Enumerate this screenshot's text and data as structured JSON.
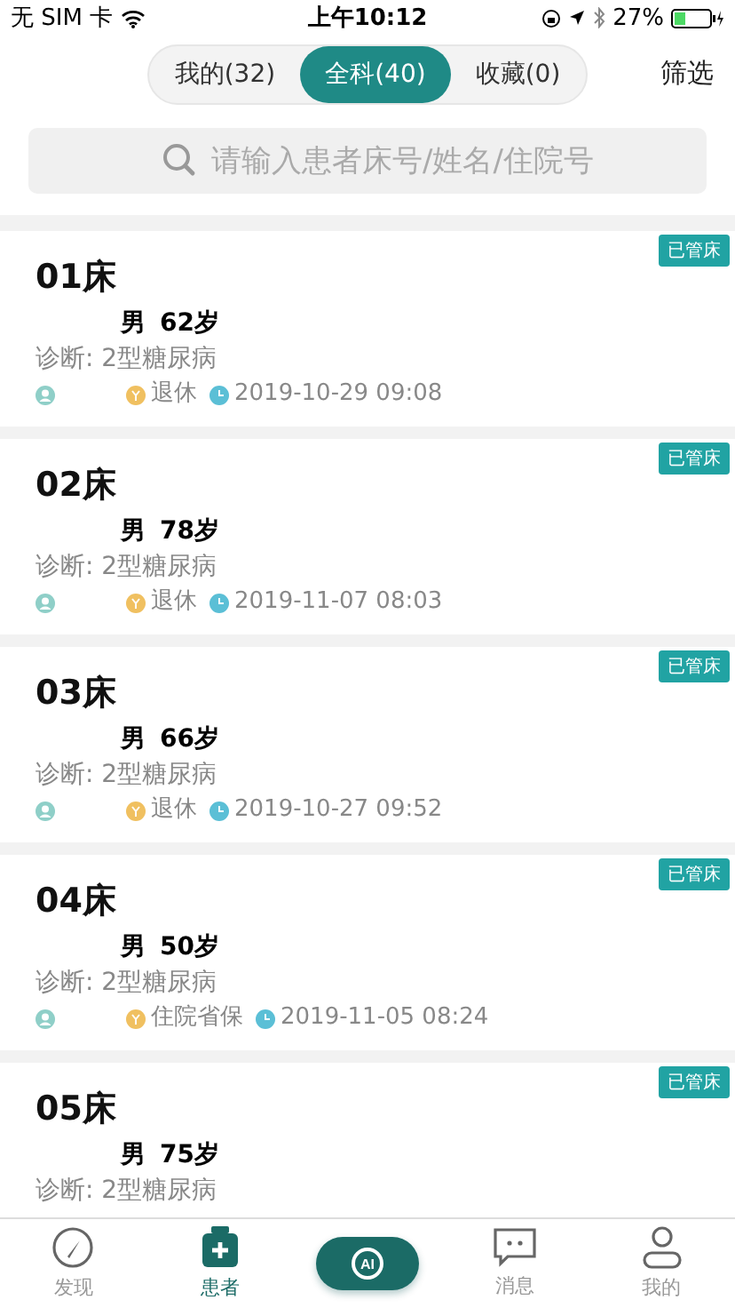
{
  "status_bar": {
    "carrier": "无 SIM 卡",
    "time": "上午10:12",
    "battery": "27%"
  },
  "tabs": [
    {
      "label": "我的(32)",
      "selected": false
    },
    {
      "label": "全科(40)",
      "selected": true
    },
    {
      "label": "收藏(0)",
      "selected": false
    }
  ],
  "filter": "筛选",
  "search": {
    "placeholder": "请输入患者床号/姓名/住院号"
  },
  "patients": [
    {
      "badge": "已管床",
      "bed": "01床",
      "gender": "男",
      "age": "62岁",
      "diagnosis": "诊断: 2型糖尿病",
      "insurance": "退休",
      "time": "2019-10-29 09:08"
    },
    {
      "badge": "已管床",
      "bed": "02床",
      "gender": "男",
      "age": "78岁",
      "diagnosis": "诊断: 2型糖尿病",
      "insurance": "退休",
      "time": "2019-11-07 08:03"
    },
    {
      "badge": "已管床",
      "bed": "03床",
      "gender": "男",
      "age": "66岁",
      "diagnosis": "诊断: 2型糖尿病",
      "insurance": "退休",
      "time": "2019-10-27 09:52"
    },
    {
      "badge": "已管床",
      "bed": "04床",
      "gender": "男",
      "age": "50岁",
      "diagnosis": "诊断: 2型糖尿病",
      "insurance": "住院省保",
      "time": "2019-11-05 08:24"
    },
    {
      "badge": "已管床",
      "bed": "05床",
      "gender": "男",
      "age": "75岁",
      "diagnosis": "诊断: 2型糖尿病"
    }
  ],
  "tab_bar": [
    {
      "kind": "compass",
      "label": "发现",
      "selected": false
    },
    {
      "kind": "kit",
      "label": "患者",
      "selected": true
    },
    {
      "kind": "ai",
      "label": "AI",
      "selected": false
    },
    {
      "kind": "chat",
      "label": "消息",
      "selected": false
    },
    {
      "kind": "person",
      "label": "我的",
      "selected": false
    }
  ]
}
